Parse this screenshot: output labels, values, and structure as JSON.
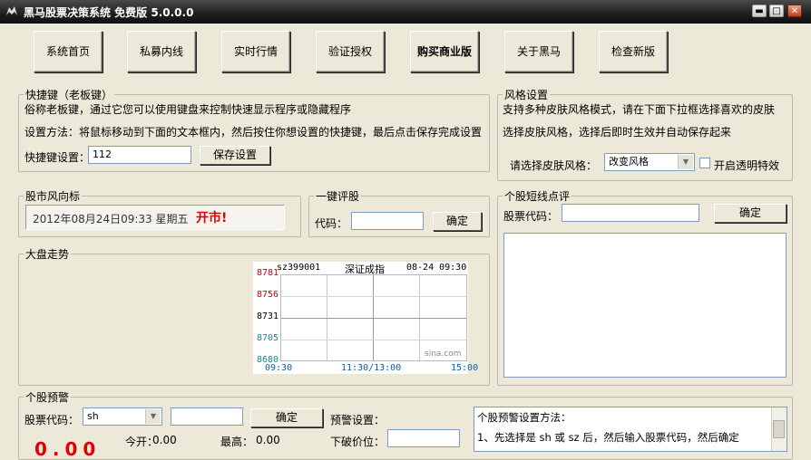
{
  "window": {
    "title": "黑马股票决策系统 免费版 5.0.0.0",
    "minimize_glyph": "▬",
    "maximize_glyph": "□",
    "close_glyph": "✕"
  },
  "nav": {
    "items": [
      "系统首页",
      "私募内线",
      "实时行情",
      "验证授权",
      "购买商业版",
      "关于黑马",
      "检查新版"
    ]
  },
  "shortcut": {
    "legend": "快捷键（老板键）",
    "line1": "俗称老板键，通过它您可以使用键盘来控制快速显示程序或隐藏程序",
    "line2": "设置方法：将鼠标移动到下面的文本框内，然后按住你想设置的快捷键，最后点击保存完成设置",
    "field_label": "快捷键设置：",
    "field_value": "112",
    "save_button": "保存设置"
  },
  "skin": {
    "legend": "风格设置",
    "line1": "支持多种皮肤风格模式，请在下面下拉框选择喜欢的皮肤",
    "line2": "选择皮肤风格，选择后即时生效并自动保存起来",
    "select_label": "请选择皮肤风格：",
    "select_value": "改变风格",
    "checkbox_label": "开启透明特效",
    "checkbox_checked": false
  },
  "market_wind": {
    "legend": "股市风向标",
    "datetime": "2012年08月24日09:33 星期五",
    "signal": "开市!",
    "signal_color": "#e00000"
  },
  "quick_rate": {
    "legend": "一键评股",
    "code_label": "代码：",
    "code_value": "",
    "confirm_button": "确定"
  },
  "stock_comment": {
    "legend": "个股短线点评",
    "code_label": "股票代码：",
    "code_value": "",
    "confirm_button": "确定",
    "result_text": ""
  },
  "market_trend": {
    "legend": "大盘走势"
  },
  "chart_data": {
    "type": "line",
    "symbol": "sz399001",
    "name": "深证成指",
    "date_time": "08-24 09:30",
    "watermark": "sina.com",
    "y_ticks": [
      {
        "label": "8781",
        "value": 8781,
        "color": "#d40000"
      },
      {
        "label": "8756",
        "value": 8756,
        "color": "#d40000"
      },
      {
        "label": "8731",
        "value": 8731,
        "color": "#000000"
      },
      {
        "label": "8705",
        "value": 8705,
        "color": "#1a8a8a"
      },
      {
        "label": "8680",
        "value": 8680,
        "color": "#1a8a8a"
      }
    ],
    "x_ticks": [
      "09:30",
      "11:30/13:00",
      "15:00"
    ],
    "series": []
  },
  "stock_alert": {
    "legend": "个股预警",
    "code_label": "股票代码：",
    "code_prefix": "sh",
    "code_value": "",
    "confirm_button": "确定",
    "setting_label": "预警设置：",
    "today_open_label": "今开：",
    "today_open_value": "0.00",
    "high_label": "最高：",
    "high_value": "0.00",
    "break_price_label": "下破价位：",
    "break_price_value": "",
    "help_title": "个股预警设置方法：",
    "help_line1": "1、先选择是 sh 或 sz 后，然后输入股票代码，然后确定",
    "price_display": "0.00"
  }
}
